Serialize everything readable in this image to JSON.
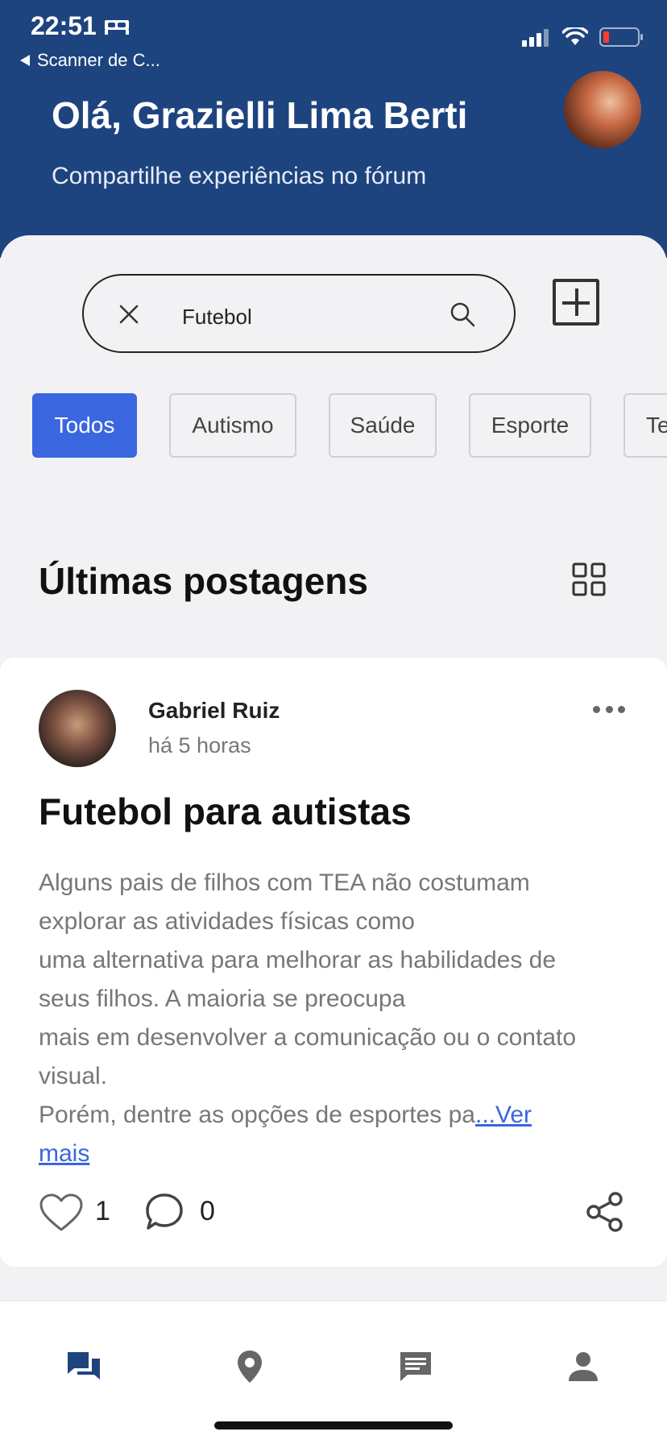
{
  "status_bar": {
    "time": "22:51",
    "back_label": "Scanner de C..."
  },
  "header": {
    "greeting": "Olá, Grazielli Lima Berti",
    "subtitle": "Compartilhe experiências no fórum"
  },
  "search": {
    "value": "Futebol"
  },
  "categories": [
    "Todos",
    "Autismo",
    "Saúde",
    "Esporte",
    "Te"
  ],
  "section": {
    "title": "Últimas postagens"
  },
  "post": {
    "author": "Gabriel Ruiz",
    "time": "há 5 horas",
    "title": "Futebol para autistas",
    "body_lines": [
      "Alguns pais de filhos com TEA não costumam",
      "explorar as atividades físicas como",
      "uma alternativa para melhorar as habilidades de",
      "seus filhos. A maioria se preocupa",
      "mais em desenvolver a comunicação ou o contato",
      "visual.",
      "Porém, dentre as opções de esportes pa"
    ],
    "read_more_1": "...Ver",
    "read_more_2": "mais",
    "likes": "1",
    "comments": "0"
  },
  "colors": {
    "header_bg": "#1e447f",
    "accent": "#3a66e0",
    "active_tab": "#1e447f"
  }
}
